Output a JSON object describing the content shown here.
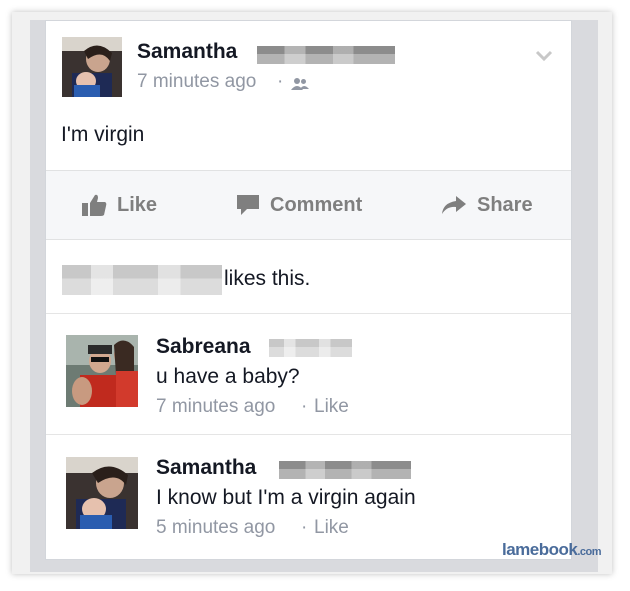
{
  "post": {
    "author": "Samantha",
    "timestamp": "7 minutes ago",
    "separator": "·",
    "audience_icon": "friends-icon",
    "text": "I'm virgin",
    "menu_icon": "chevron-down-icon"
  },
  "actions": {
    "like_label": "Like",
    "comment_label": "Comment",
    "share_label": "Share"
  },
  "likes": {
    "suffix": "likes this."
  },
  "comments": [
    {
      "author": "Sabreana",
      "text": "u have a baby?",
      "timestamp": "7 minutes ago",
      "like_label": "Like"
    },
    {
      "author": "Samantha",
      "text": "I know but I'm a virgin again",
      "timestamp": "5 minutes ago",
      "like_label": "Like"
    }
  ],
  "watermark": {
    "main": "lamebook",
    "suffix": ".com"
  },
  "colors": {
    "name": "#141823",
    "meta": "#9197a3",
    "action": "#7f7f7f",
    "watermark": "#4a6c9b"
  }
}
